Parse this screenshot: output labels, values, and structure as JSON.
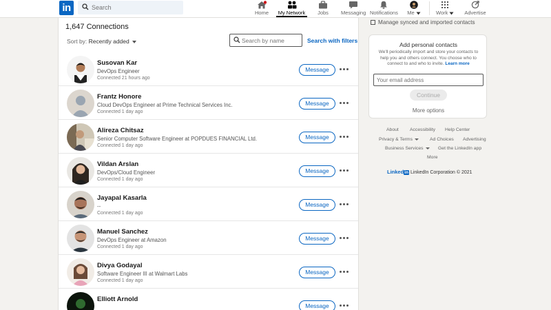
{
  "nav": {
    "logo": "in",
    "search_placeholder": "Search",
    "items": [
      {
        "label": "Home",
        "icon": "home-icon"
      },
      {
        "label": "My Network",
        "icon": "network-icon"
      },
      {
        "label": "Jobs",
        "icon": "briefcase-icon"
      },
      {
        "label": "Messaging",
        "icon": "chat-icon"
      },
      {
        "label": "Notifications",
        "icon": "bell-icon"
      },
      {
        "label": "Me",
        "icon": "avatar-icon"
      },
      {
        "label": "Work",
        "icon": "grid-icon"
      },
      {
        "label": "Advertise",
        "icon": "advertise-icon"
      }
    ],
    "active_color": "#000000",
    "brand_color": "#0a66c2"
  },
  "connections": {
    "count_label": "1,647 Connections",
    "sort_label": "Sort by:",
    "sort_value": "Recently added",
    "search_placeholder": "Search by name",
    "search_filters_label": "Search with filters",
    "message_label": "Message",
    "rows": [
      {
        "name": "Susovan Kar",
        "headline": "DevOps Engineer",
        "since": "Connected 21 hours ago"
      },
      {
        "name": "Frantz Honore",
        "headline": "Cloud DevOps Engineer at Prime Technical Services Inc.",
        "since": "Connected 1 day ago"
      },
      {
        "name": "Alireza Chitsaz",
        "headline": "Senior Computer Software Engineer at POPDUES FINANCIAL Ltd.",
        "since": "Connected 1 day ago"
      },
      {
        "name": "Vildan Arslan",
        "headline": "DevOps/Cloud Engineer",
        "since": "Connected 1 day ago"
      },
      {
        "name": "Jayapal Kasarla",
        "headline": "--",
        "since": "Connected 1 day ago"
      },
      {
        "name": "Manuel Sanchez",
        "headline": "DevOps Engineer at Amazon",
        "since": "Connected 1 day ago"
      },
      {
        "name": "Divya Godayal",
        "headline": "Software Engineer III at Walmart Labs",
        "since": "Connected 1 day ago"
      },
      {
        "name": "Elliott Arnold",
        "headline": "",
        "since": ""
      }
    ]
  },
  "sidebar": {
    "manage_label": "Manage synced and imported contacts",
    "contacts_title": "Add personal contacts",
    "contacts_desc": "We'll periodically import and store your contacts to help you and others connect. You choose who to connect to and who to invite.",
    "learn_more": "Learn more",
    "email_placeholder": "Your email address",
    "continue_label": "Continue",
    "more_options": "More options"
  },
  "footer": {
    "about": "About",
    "accessibility": "Accessibility",
    "help_center": "Help Center",
    "privacy_terms": "Privacy & Terms",
    "ad_choices": "Ad Choices",
    "advertising": "Advertising",
    "business_services": "Business Services",
    "get_app": "Get the LinkedIn app",
    "more": "More",
    "brand_linked": "Linked",
    "brand_in": "in",
    "copyright": "LinkedIn Corporation © 2021"
  }
}
